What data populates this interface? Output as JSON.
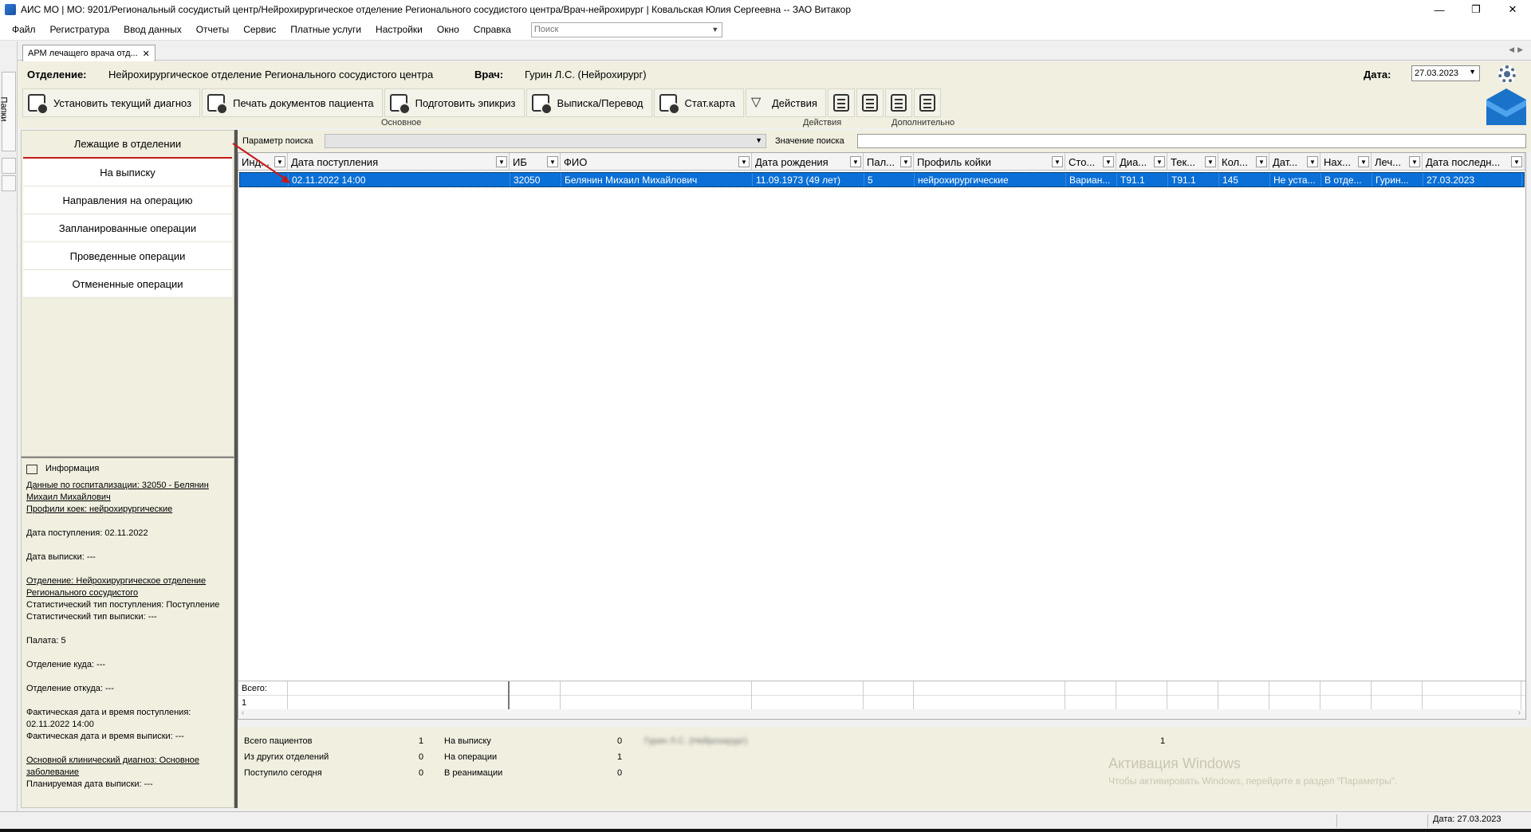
{
  "window": {
    "title": "АИС МО | МО: 9201/Региональный сосудистый центр/Нейрохирургическое отделение Регионального сосудистого центра/Врач-нейрохирург | Ковальская Юлия Сергеевна -- ЗАО Витакор",
    "minimize": "—",
    "restore": "❐",
    "close": "✕"
  },
  "menu": {
    "items": [
      "Файл",
      "Регистратура",
      "Ввод данных",
      "Отчеты",
      "Сервис",
      "Платные услуги",
      "Настройки",
      "Окно",
      "Справка"
    ],
    "search_placeholder": "Поиск"
  },
  "left_rail": {
    "folders_label": "Папки"
  },
  "doc_tab": {
    "label": "АРМ лечащего врача отд...",
    "close": "✕"
  },
  "header": {
    "department_label": "Отделение:",
    "department_value": "Нейрохирургическое отделение Регионального сосудистого центра",
    "doctor_label": "Врач:",
    "doctor_value": "Гурин Л.С. (Нейрохирург)",
    "date_label": "Дата:",
    "date_value": "27.03.2023"
  },
  "toolbar": {
    "main_buttons": [
      {
        "label": "Установить текущий диагноз",
        "icon": "diagnosis-icon"
      },
      {
        "label": "Печать документов пациента",
        "icon": "print-patient-icon"
      },
      {
        "label": "Подготовить эпикриз",
        "icon": "epicrisis-icon"
      },
      {
        "label": "Выписка/Перевод",
        "icon": "discharge-icon"
      },
      {
        "label": "Стат.карта",
        "icon": "stat-card-icon"
      }
    ],
    "actions_label": "Действия",
    "group_main": "Основное",
    "group_actions": "Действия",
    "group_extra": "Дополнительно"
  },
  "nav": {
    "items": [
      "Лежащие в отделении",
      "На выписку",
      "Направления на операцию",
      "Запланированные операции",
      "Проведенные операции",
      "Отмененные операции"
    ]
  },
  "info": {
    "title": "Информация",
    "hosp_link": "Данные по госпитализации: 32050 - Белянин Михаил Михайлович",
    "profile_link": "Профили коек: нейрохирургические",
    "admission": "Дата поступления: 02.11.2022",
    "discharge": "Дата выписки: ---",
    "dept_link": "Отделение: Нейрохирургическое отделение Регионального сосудистого",
    "stat_type_in": "Статистический тип поступления: Поступление",
    "stat_type_out": "Статистический тип выписки: ---",
    "ward": "Палата: 5",
    "dept_to": "Отделение куда: ---",
    "dept_from": "Отделение откуда: ---",
    "actual_in": "Фактическая дата и время поступления: 02.11.2022 14:00",
    "actual_out": "Фактическая дата и время выписки: ---",
    "diag_link": "Основной клинический диагноз: Основное заболевание",
    "planned_out": "Планируемая дата выписки: ---"
  },
  "search": {
    "param_label": "Параметр поиска",
    "value_label": "Значение поиска"
  },
  "grid": {
    "columns": [
      "Инд...",
      "Дата поступления",
      "ИБ",
      "ФИО",
      "Дата рождения",
      "Пал...",
      "Профиль койки",
      "Сто...",
      "Диа...",
      "Тек...",
      "Кол...",
      "Дат...",
      "Нах...",
      "Леч...",
      "Дата последн..."
    ],
    "rows": [
      [
        "",
        "02.11.2022 14:00",
        "32050",
        "Белянин Михаил Михайлович",
        "11.09.1973 (49 лет)",
        "5",
        "нейрохирургические",
        "Вариан...",
        "T91.1",
        "T91.1",
        "145",
        "Не уста...",
        "В отде...",
        "Гурин...",
        "27.03.2023"
      ]
    ],
    "total_label": "Всего:",
    "total_count": "1"
  },
  "stats": {
    "total_patients_label": "Всего пациентов",
    "total_patients": "1",
    "from_other_label": "Из других отделений",
    "from_other": "0",
    "today_label": "Поступило сегодня",
    "today": "0",
    "to_discharge_label": "На выписку",
    "to_discharge": "0",
    "on_operation_label": "На операции",
    "on_operation": "1",
    "resus_label": "В реанимации",
    "resus": "0",
    "blurred_doctor": "Гурин Л.С. (Нейрохирург)",
    "doctor_count": "1"
  },
  "watermark": {
    "line1": "Активация Windows",
    "line2": "Чтобы активировать Windows, перейдите в раздел \"Параметры\"."
  },
  "status": {
    "date": "Дата: 27.03.2023"
  },
  "colors": {
    "selection": "#0a6fd6",
    "panel": "#f1efe0",
    "accent_red": "#c51a1a",
    "logo_blue": "#1a73c8"
  }
}
